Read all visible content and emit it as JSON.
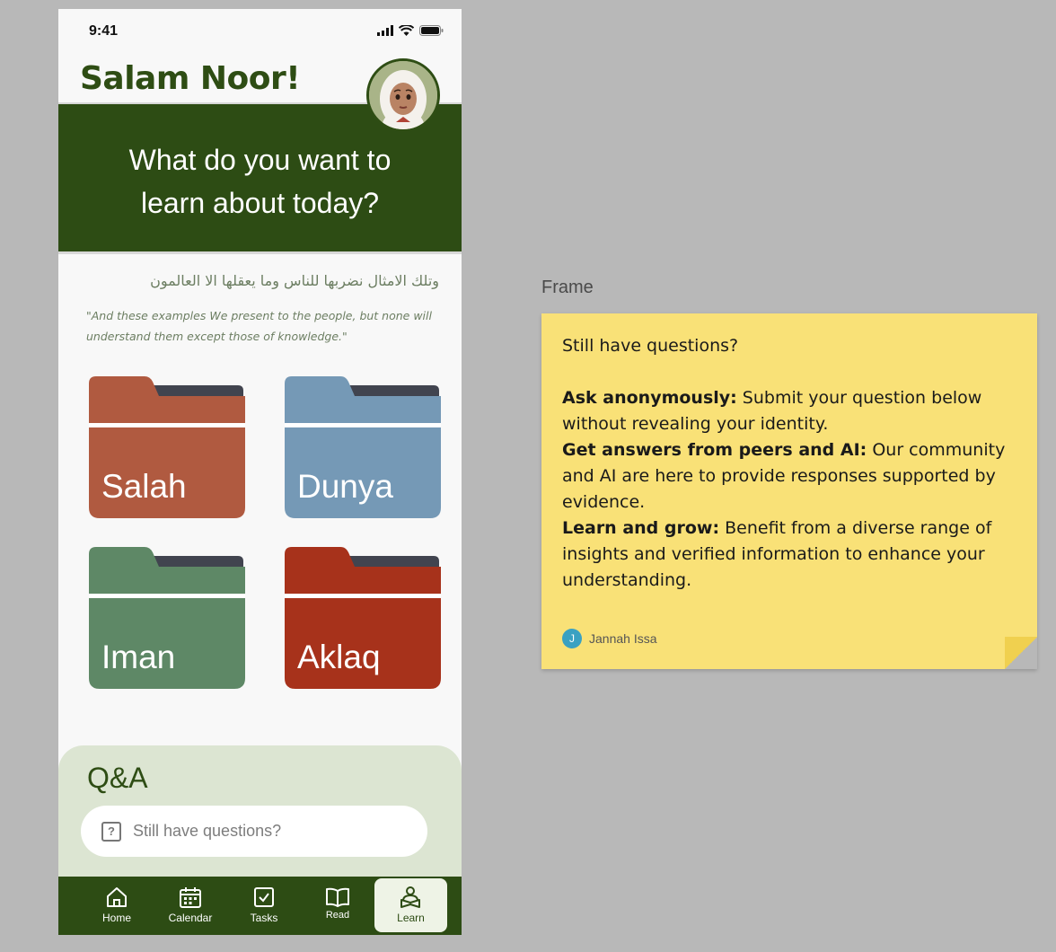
{
  "status_bar": {
    "time": "9:41"
  },
  "header": {
    "greeting": "Salam Noor!"
  },
  "hero": {
    "line1": "What do you want to",
    "line2": "learn about today?"
  },
  "verse": {
    "arabic": "وتلك الامثال نضربها للناس وما يعقلها الا العالمون",
    "translation": "\"And these examples We present to the people, but none will understand them except those of knowledge.\""
  },
  "folders": [
    {
      "label": "Salah",
      "color": "#b05a40"
    },
    {
      "label": "Dunya",
      "color": "#7599b6"
    },
    {
      "label": "Iman",
      "color": "#5e8866"
    },
    {
      "label": "Aklaq",
      "color": "#a7321b"
    }
  ],
  "qa": {
    "title": "Q&A",
    "placeholder": "Still have questions?",
    "icon": "question-icon"
  },
  "nav": {
    "items": [
      {
        "label": "Home",
        "icon": "home-icon"
      },
      {
        "label": "Calendar",
        "icon": "calendar-icon"
      },
      {
        "label": "Tasks",
        "icon": "tasks-icon"
      },
      {
        "label": "Read",
        "icon": "book-icon"
      },
      {
        "label": "Learn",
        "icon": "learn-icon",
        "active": true
      }
    ]
  },
  "canvas": {
    "frame_label": "Frame"
  },
  "sticky_note": {
    "intro": "Still have questions?",
    "points": [
      {
        "title": "Ask anonymously:",
        "text": " Submit your question below without revealing your identity."
      },
      {
        "title": "Get answers from peers and AI:",
        "text": " Our community and AI are here to provide responses supported by evidence."
      },
      {
        "title": "Learn and grow:",
        "text": " Benefit from a diverse range of insights and verified information to enhance your understanding."
      }
    ],
    "author_initial": "J",
    "author": "Jannah Issa"
  },
  "colors": {
    "brand_green": "#2d4c14",
    "qa_background": "#dce5d2",
    "sticky_yellow": "#f9e177",
    "canvas_gray": "#b8b8b8"
  }
}
